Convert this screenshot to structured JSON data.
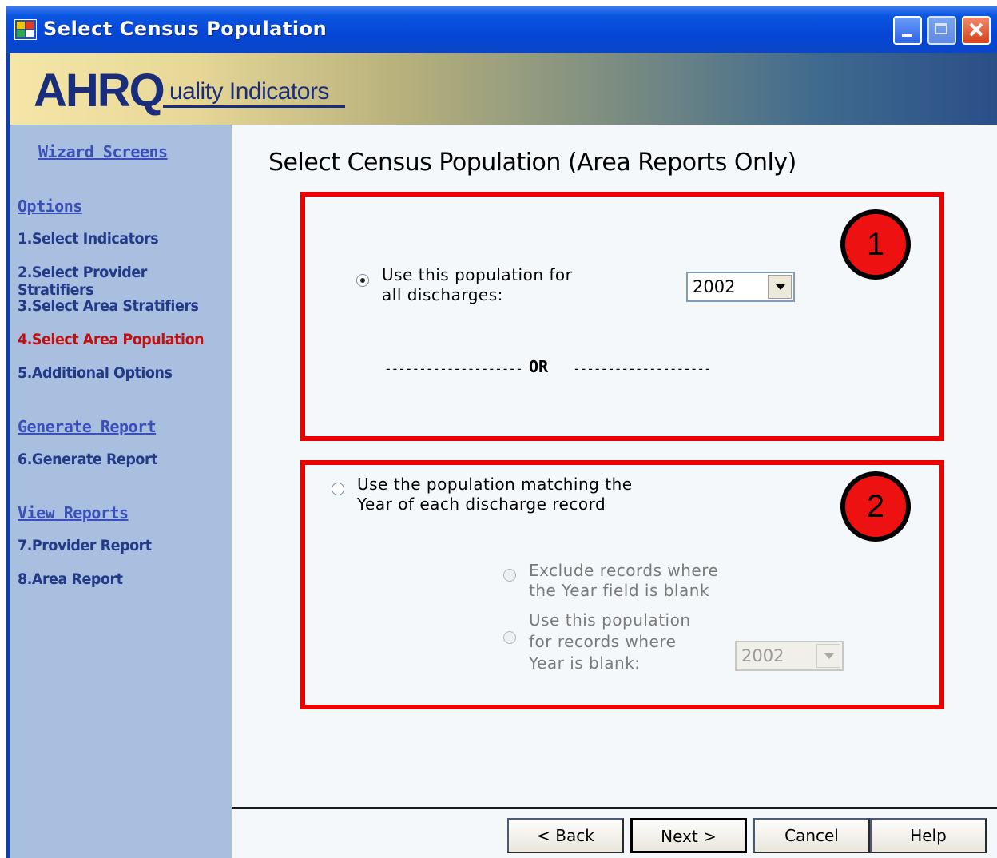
{
  "window": {
    "title": "Select Census Population"
  },
  "banner": {
    "logo_bold": "AHRQ",
    "logo_rest": "uality Indicators"
  },
  "sidebar": {
    "heading": "Wizard Screens",
    "sections": [
      {
        "label": "Options",
        "items": [
          "1.Select Indicators",
          "2.Select Provider Stratifiers",
          "3.Select Area Stratifiers",
          "4.Select Area Population",
          "5.Additional Options"
        ]
      },
      {
        "label": "Generate Report",
        "items": [
          "6.Generate Report"
        ]
      },
      {
        "label": "View Reports",
        "items": [
          "7.Provider Report",
          "8.Area Report"
        ]
      }
    ],
    "active_item": "4.Select Area Population"
  },
  "main": {
    "title": "Select Census Population (Area Reports Only)",
    "box1": {
      "badge": "1",
      "option_label_line1": "Use this population for",
      "option_label_line2": "all discharges:",
      "selected": true,
      "year_value": "2002",
      "separator_left": "--------------------",
      "or_label": "OR",
      "separator_right": "--------------------"
    },
    "box2": {
      "badge": "2",
      "option_label_line1": "Use the population matching the",
      "option_label_line2": "Year of each discharge record",
      "selected": false,
      "sub_option1_line1": "Exclude records where",
      "sub_option1_line2": "the Year field is blank",
      "sub_option2_line1": "Use this population",
      "sub_option2_line2": "for records where",
      "sub_option2_line3": "Year is blank:",
      "year_value": "2002"
    }
  },
  "footer": {
    "back_label": "< Back",
    "next_label": "Next >",
    "cancel_label": "Cancel",
    "help_label": "Help"
  },
  "colors": {
    "titlebar": "#0546d6",
    "sidebar_bg": "#a8bfe0",
    "active_item": "#c01010",
    "highlight_box": "#ee0000"
  }
}
